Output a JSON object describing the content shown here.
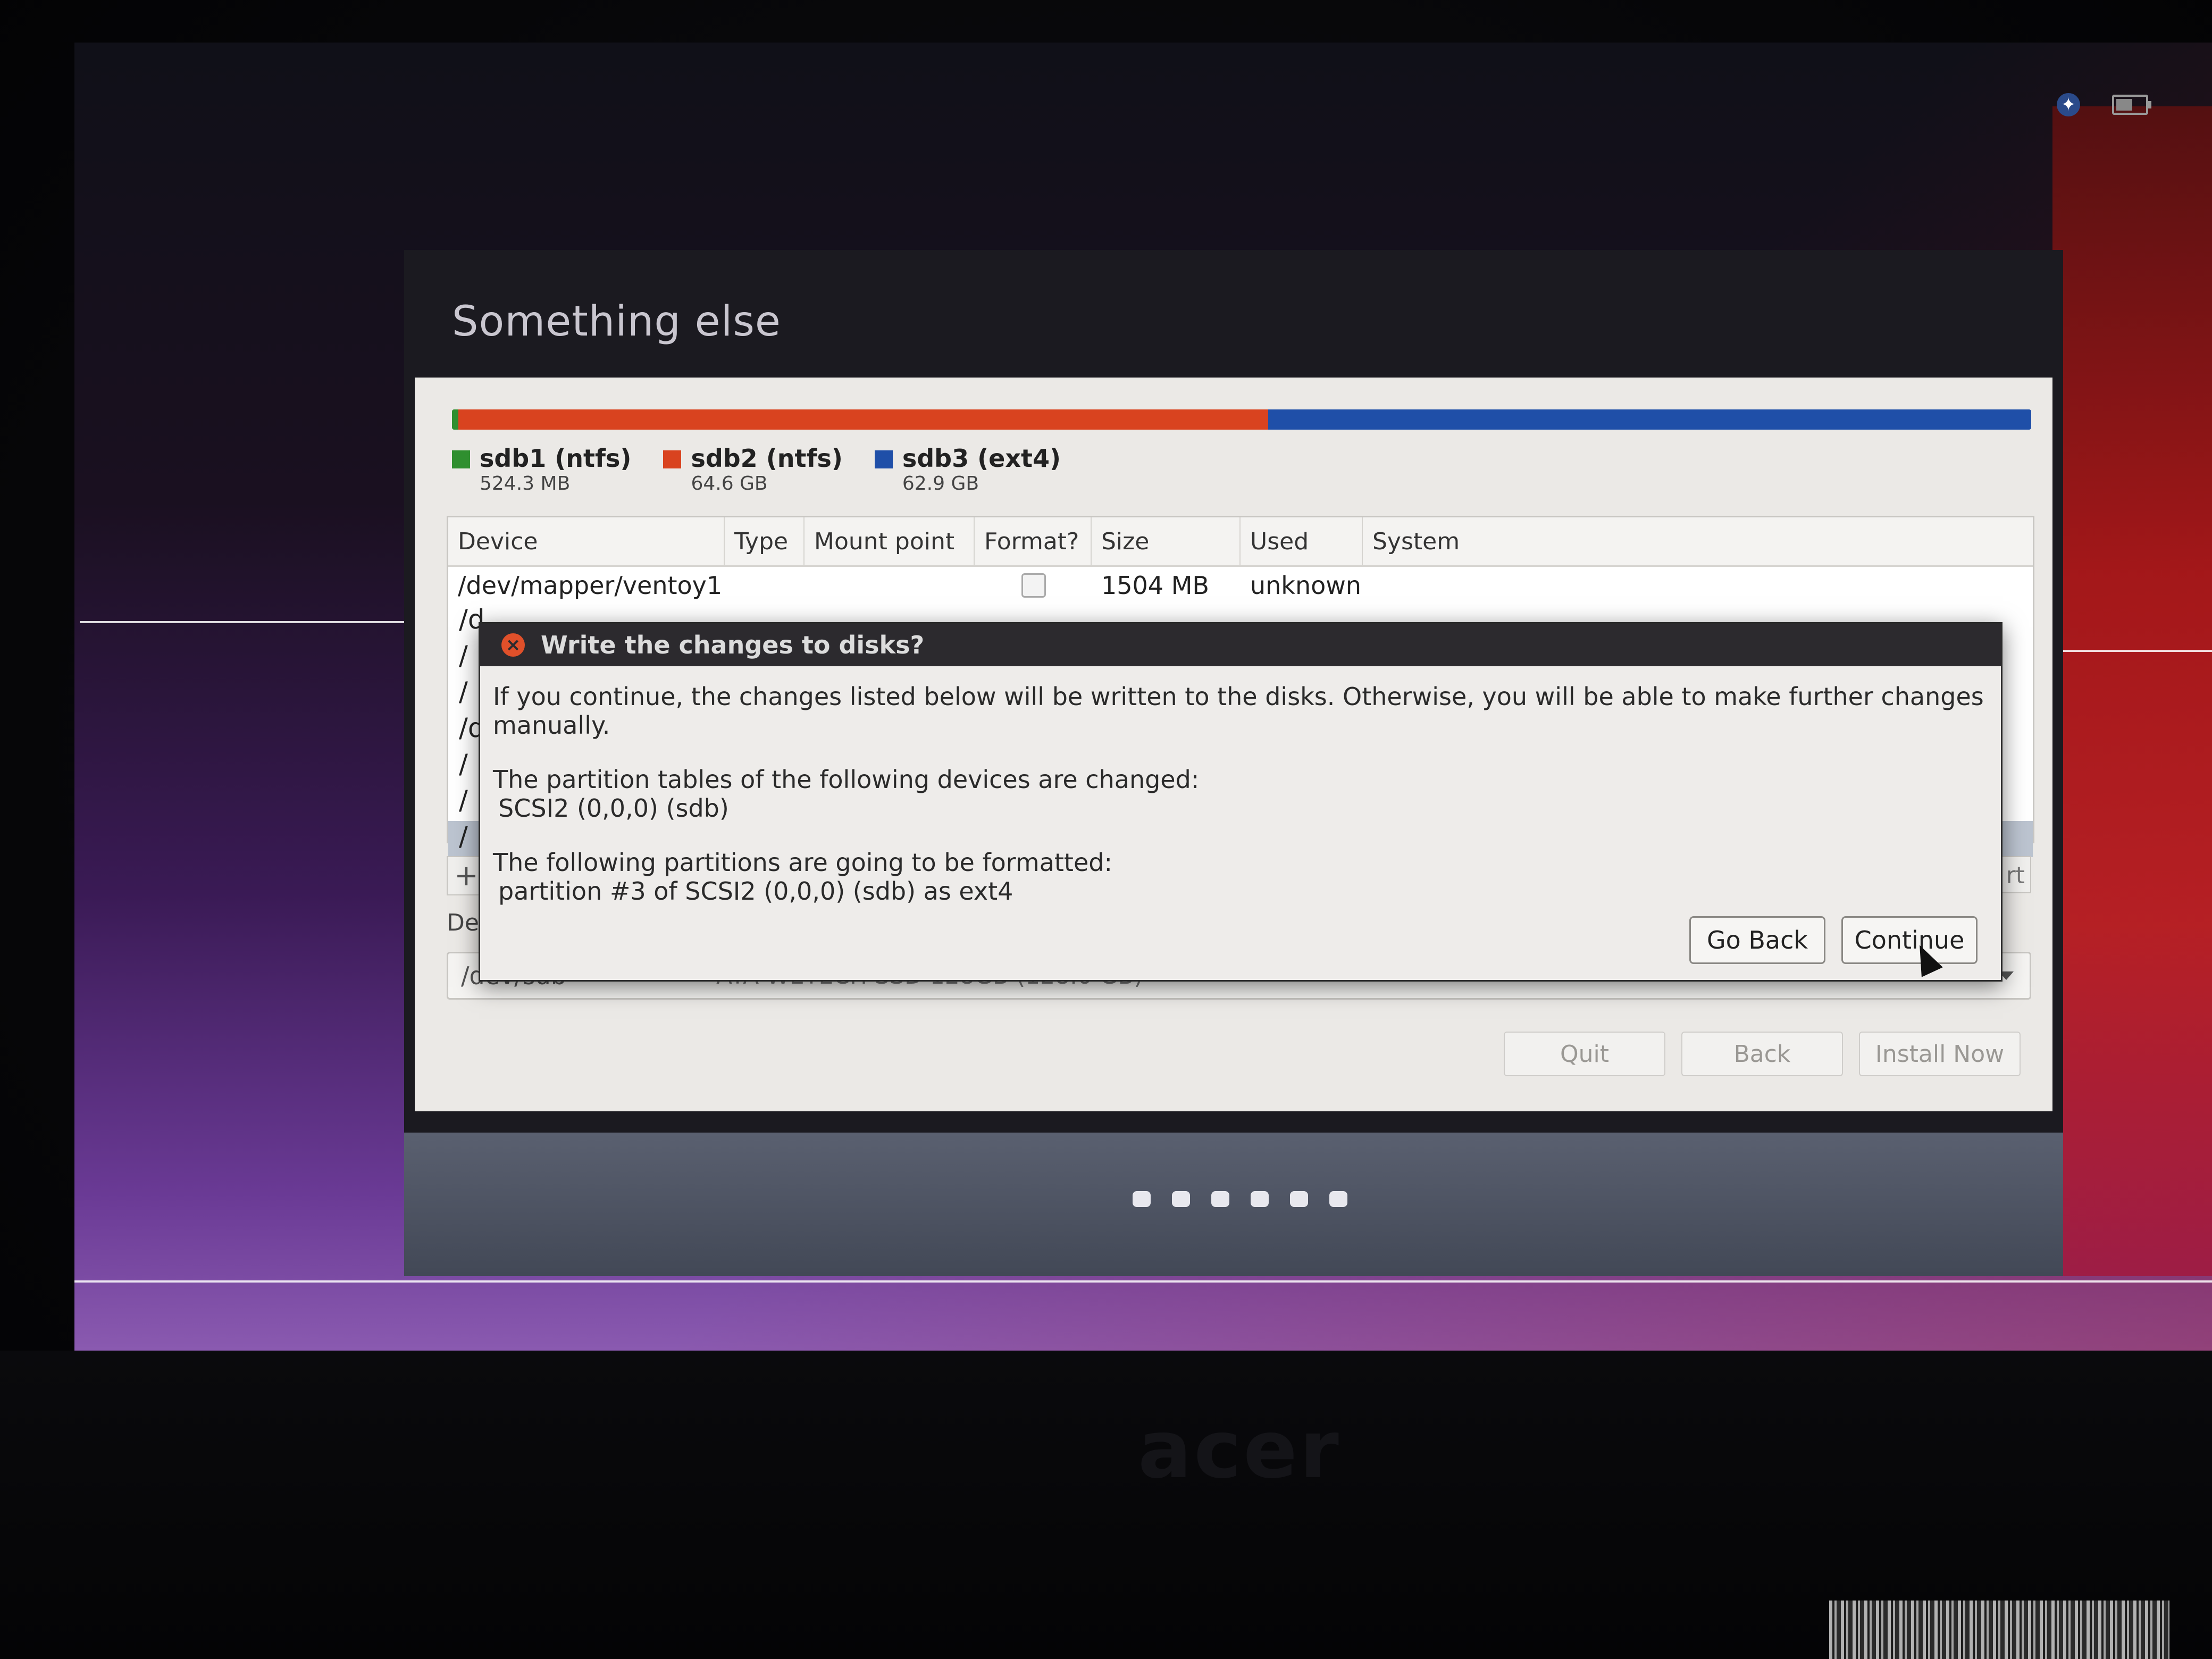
{
  "installer": {
    "title": "Something else"
  },
  "partitions": [
    {
      "name": "sdb1 (ntfs)",
      "size": "524.3 MB",
      "color": "#2f8f2f",
      "share": 0.004
    },
    {
      "name": "sdb2 (ntfs)",
      "size": "64.6 GB",
      "color": "#d9431f",
      "share": 0.513
    },
    {
      "name": "sdb3 (ext4)",
      "size": "62.9 GB",
      "color": "#1f4fa8",
      "share": 0.483
    }
  ],
  "table": {
    "headers": [
      "Device",
      "Type",
      "Mount point",
      "Format?",
      "Size",
      "Used",
      "System"
    ],
    "first_row": {
      "device": "/dev/mapper/ventoy1",
      "size": "1504 MB",
      "used": "unknown"
    },
    "stub_rows": [
      "/d",
      "/",
      "/",
      "/d",
      "/",
      "/",
      "/"
    ]
  },
  "controls": {
    "add": "+",
    "change_stub": "rt",
    "device_label": "De",
    "bootloader_device": "/dev/sdb",
    "bootloader_desc": "ATA WETECH SSD 128GB (128.0 GB)"
  },
  "nav": {
    "quit": "Quit",
    "back": "Back",
    "install": "Install Now"
  },
  "dialog": {
    "title": "Write the changes to disks?",
    "intro": "If you continue, the changes listed below will be written to the disks. Otherwise, you will be able to make further changes manually.",
    "tables_heading": "The partition tables of the following devices are changed:",
    "tables_device": "SCSI2 (0,0,0) (sdb)",
    "format_heading": "The following partitions are going to be formatted:",
    "format_item": "partition #3 of SCSI2 (0,0,0) (sdb) as ext4",
    "go_back": "Go Back",
    "continue": "Continue"
  },
  "monitor": {
    "brand": "acer"
  },
  "icons": {
    "accessibility": "accessibility-icon",
    "battery": "battery-icon",
    "close": "close-icon",
    "cursor": "cursor-icon"
  }
}
